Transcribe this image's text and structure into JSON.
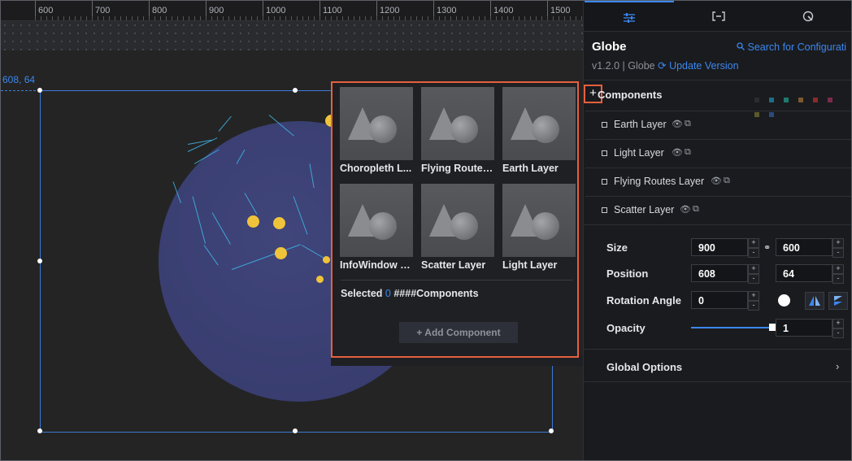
{
  "ruler": {
    "labels": [
      "600",
      "700",
      "800",
      "900",
      "1000",
      "1100",
      "1200",
      "1300",
      "1400",
      "1500"
    ]
  },
  "canvas": {
    "coord_label": "608, 64"
  },
  "popover": {
    "cards": [
      {
        "label": "Choropleth L..."
      },
      {
        "label": "Flying Routes..."
      },
      {
        "label": "Earth Layer"
      },
      {
        "label": "InfoWindow L..."
      },
      {
        "label": "Scatter Layer"
      },
      {
        "label": "Light Layer"
      }
    ],
    "selected_prefix": "Selected",
    "selected_count": "0",
    "selected_suffix": "####Components",
    "add_button": "+ Add Component"
  },
  "panel": {
    "tabs": [
      {
        "icon": "sliders-icon",
        "glyph": "☰"
      },
      {
        "icon": "bracket-icon",
        "glyph": "[–]"
      },
      {
        "icon": "interaction-icon",
        "glyph": "◌"
      }
    ],
    "title": "Globe",
    "search": "Search for Configurati",
    "version_text": "v1.2.0 | Globe",
    "update_link": "Update Version",
    "components_title": "Components",
    "add_symbol": "+",
    "swatch_colors": [
      "#2a2c30",
      "#1c6d8a",
      "#1f7a6e",
      "#7a5a30",
      "#8a2a2a",
      "#7a2a4a",
      "#5a5a2a",
      "#2a4a7a"
    ],
    "layers": [
      {
        "label": "Earth Layer"
      },
      {
        "label": "Light Layer"
      },
      {
        "label": "Flying Routes Layer"
      },
      {
        "label": "Scatter Layer"
      }
    ],
    "size_label": "Size",
    "size_w": "900",
    "size_h": "600",
    "position_label": "Position",
    "pos_x": "608",
    "pos_y": "64",
    "rotation_label": "Rotation Angle",
    "rotation_value": "0",
    "opacity_label": "Opacity",
    "opacity_value": "1",
    "opacity_fraction": 1,
    "global_options": "Global Options"
  },
  "colors": {
    "accent": "#3b87f0",
    "highlight": "#e5603e",
    "point": "#f0c43a",
    "globe": "#3b3f72"
  }
}
